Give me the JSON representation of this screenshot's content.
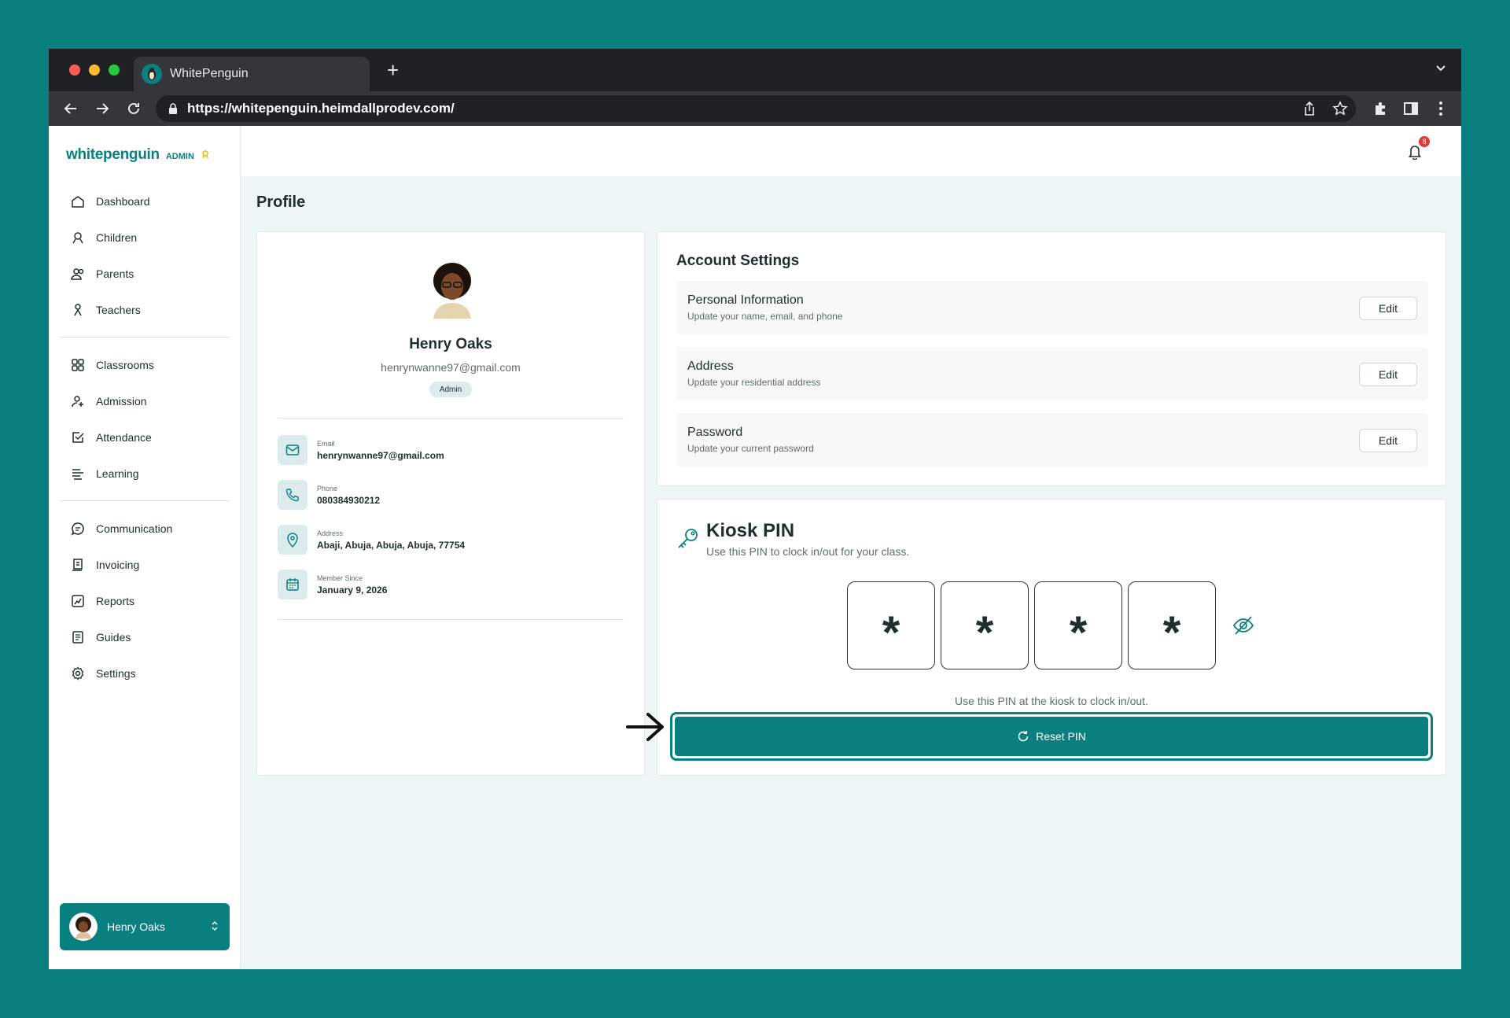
{
  "browser": {
    "tab_title": "WhitePenguin",
    "url": "https://whitepenguin.heimdallprodev.com/"
  },
  "brand": {
    "logo": "whitepenguin",
    "role": "ADMIN"
  },
  "sidebar": {
    "items": [
      {
        "label": "Dashboard",
        "icon": "dashboard-icon"
      },
      {
        "label": "Children",
        "icon": "children-icon"
      },
      {
        "label": "Parents",
        "icon": "parents-icon"
      },
      {
        "label": "Teachers",
        "icon": "teachers-icon"
      },
      {
        "label": "Classrooms",
        "icon": "classrooms-icon"
      },
      {
        "label": "Admission",
        "icon": "admission-icon"
      },
      {
        "label": "Attendance",
        "icon": "attendance-icon"
      },
      {
        "label": "Learning",
        "icon": "learning-icon"
      },
      {
        "label": "Communication",
        "icon": "communication-icon"
      },
      {
        "label": "Invoicing",
        "icon": "invoicing-icon"
      },
      {
        "label": "Reports",
        "icon": "reports-icon"
      },
      {
        "label": "Guides",
        "icon": "guides-icon"
      },
      {
        "label": "Settings",
        "icon": "settings-icon"
      }
    ],
    "user": "Henry Oaks"
  },
  "topbar": {
    "notification_count": "8"
  },
  "page": {
    "title": "Profile"
  },
  "profile": {
    "name": "Henry Oaks",
    "email": "henrynwanne97@gmail.com",
    "role": "Admin",
    "details": [
      {
        "label": "Email",
        "value": "henrynwanne97@gmail.com"
      },
      {
        "label": "Phone",
        "value": "080384930212"
      },
      {
        "label": "Address",
        "value": "Abaji, Abuja, Abuja, Abuja, 77754"
      },
      {
        "label": "Member Since",
        "value": "January 9, 2026"
      }
    ]
  },
  "account": {
    "title": "Account Settings",
    "rows": [
      {
        "title": "Personal Information",
        "subtitle": "Update your name, email, and phone",
        "button": "Edit"
      },
      {
        "title": "Address",
        "subtitle": "Update your residential address",
        "button": "Edit"
      },
      {
        "title": "Password",
        "subtitle": "Update your current password",
        "button": "Edit"
      }
    ]
  },
  "kiosk": {
    "title": "Kiosk PIN",
    "subtitle": "Use this PIN to clock in/out for your class.",
    "pin": [
      "*",
      "*",
      "*",
      "*"
    ],
    "note": "Use this PIN at the kiosk to clock in/out.",
    "reset_label": "Reset PIN"
  },
  "colors": {
    "accent": "#0a7f7f",
    "badge": "#e53935"
  }
}
